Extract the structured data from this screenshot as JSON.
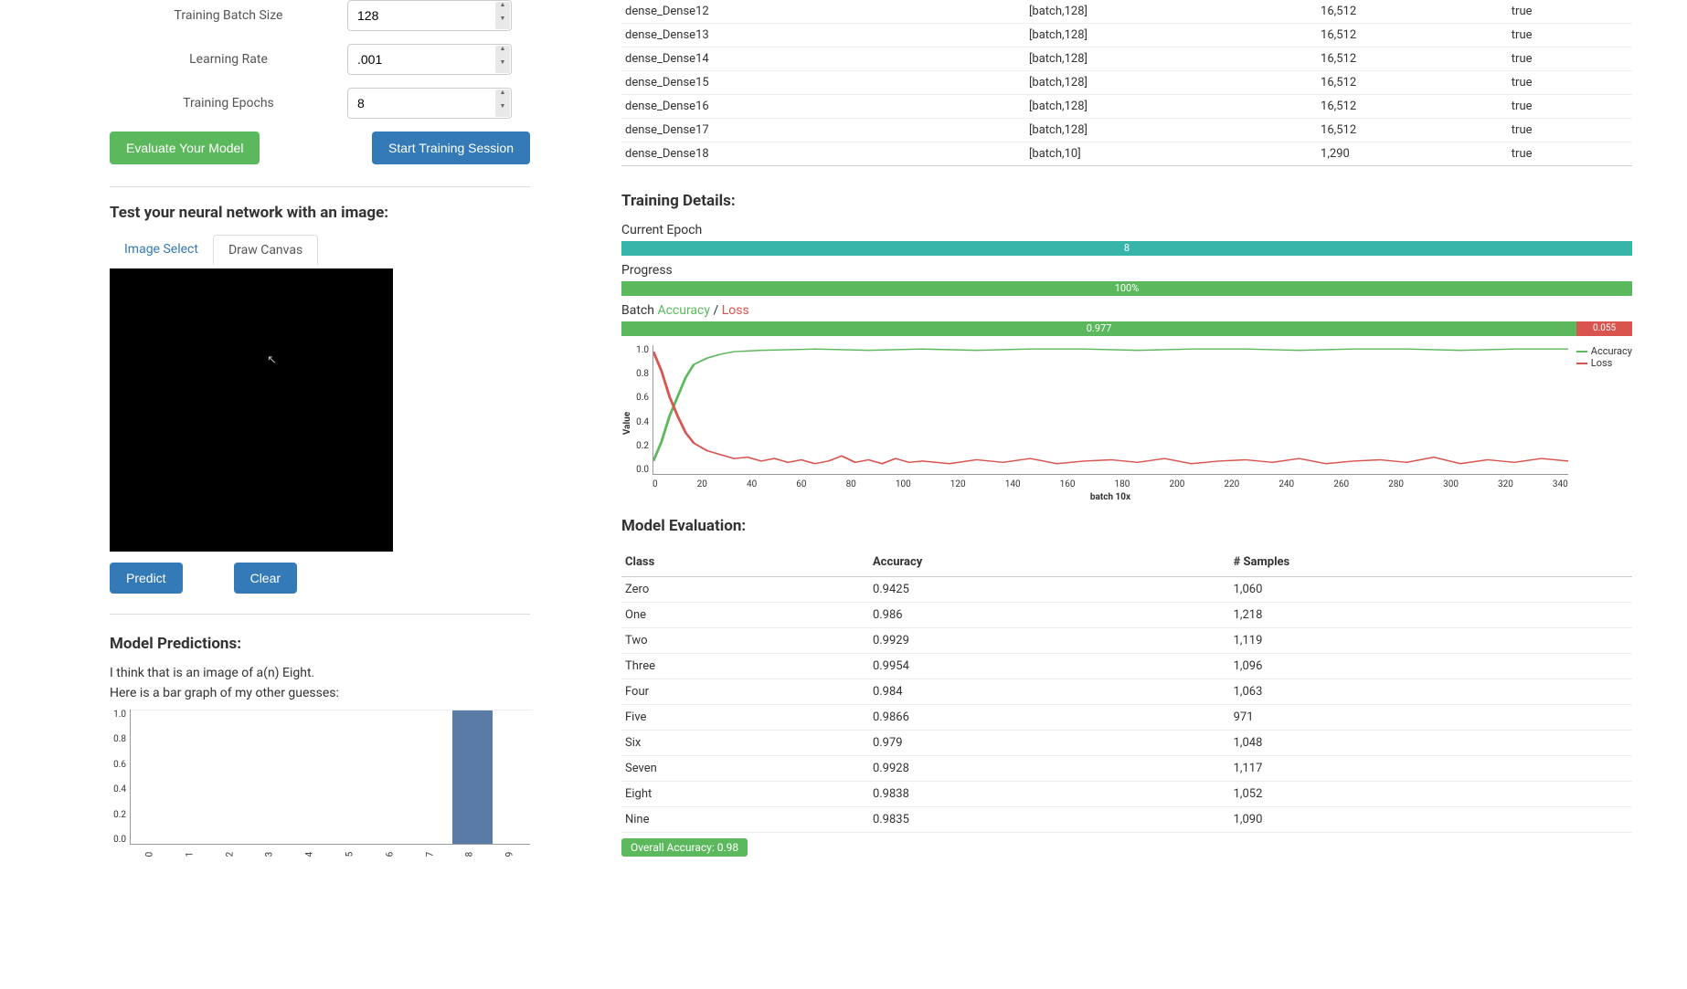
{
  "form": {
    "batch_label": "Training Batch Size",
    "batch_value": "128",
    "lr_label": "Learning Rate",
    "lr_value": ".001",
    "epochs_label": "Training Epochs",
    "epochs_value": "8",
    "evaluate_btn": "Evaluate Your Model",
    "train_btn": "Start Training Session"
  },
  "test": {
    "heading": "Test your neural network with an image:",
    "tab_select": "Image Select",
    "tab_draw": "Draw Canvas",
    "predict_btn": "Predict",
    "clear_btn": "Clear"
  },
  "predictions": {
    "heading": "Model Predictions:",
    "line1": "I think that is an image of a(n) Eight.",
    "line2": "Here is a bar graph of my other guesses:"
  },
  "chart_data": {
    "predictions_bar": {
      "type": "bar",
      "categories": [
        "0",
        "1",
        "2",
        "3",
        "4",
        "5",
        "6",
        "7",
        "8",
        "9"
      ],
      "values": [
        0,
        0,
        0,
        0,
        0,
        0,
        0,
        0,
        1.0,
        0
      ],
      "ylim": [
        0,
        1.0
      ],
      "yticks": [
        "0.0",
        "0.2",
        "0.4",
        "0.6",
        "0.8",
        "1.0"
      ]
    },
    "training_line": {
      "type": "line",
      "xlabel": "batch 10x",
      "ylabel": "Value",
      "xlim": [
        0,
        340
      ],
      "ylim": [
        0,
        1.0
      ],
      "xticks": [
        "0",
        "20",
        "40",
        "60",
        "80",
        "100",
        "120",
        "140",
        "160",
        "180",
        "200",
        "220",
        "240",
        "260",
        "280",
        "300",
        "320",
        "340"
      ],
      "yticks": [
        "0.0",
        "0.2",
        "0.4",
        "0.6",
        "0.8",
        "1.0"
      ],
      "series": [
        {
          "name": "Accuracy",
          "color": "#5cb85c",
          "values_summary": "rises from ~0.1 to ~0.97 by batch ~30 then plateaus near 0.97"
        },
        {
          "name": "Loss",
          "color": "#d9534f",
          "values_summary": "drops from ~1.0 to ~0.1 by batch ~30 then noisy around 0.05-0.15"
        }
      ]
    }
  },
  "layers": [
    {
      "name": "dense_Dense12",
      "shape": "[batch,128]",
      "params": "16,512",
      "trainable": "true"
    },
    {
      "name": "dense_Dense13",
      "shape": "[batch,128]",
      "params": "16,512",
      "trainable": "true"
    },
    {
      "name": "dense_Dense14",
      "shape": "[batch,128]",
      "params": "16,512",
      "trainable": "true"
    },
    {
      "name": "dense_Dense15",
      "shape": "[batch,128]",
      "params": "16,512",
      "trainable": "true"
    },
    {
      "name": "dense_Dense16",
      "shape": "[batch,128]",
      "params": "16,512",
      "trainable": "true"
    },
    {
      "name": "dense_Dense17",
      "shape": "[batch,128]",
      "params": "16,512",
      "trainable": "true"
    },
    {
      "name": "dense_Dense18",
      "shape": "[batch,10]",
      "params": "1,290",
      "trainable": "true"
    }
  ],
  "training": {
    "heading": "Training Details:",
    "epoch_label": "Current Epoch",
    "epoch_value": "8",
    "progress_label": "Progress",
    "progress_value": "100%",
    "batch_label_prefix": "Batch ",
    "batch_acc_word": "Accuracy",
    "batch_sep": " / ",
    "batch_loss_word": "Loss",
    "acc_value": "0.977",
    "loss_value": "0.055",
    "legend_acc": "Accuracy",
    "legend_loss": "Loss"
  },
  "evaluation": {
    "heading": "Model Evaluation:",
    "col_class": "Class",
    "col_acc": "Accuracy",
    "col_samples": "# Samples",
    "rows": [
      {
        "class": "Zero",
        "acc": "0.9425",
        "samples": "1,060"
      },
      {
        "class": "One",
        "acc": "0.986",
        "samples": "1,218"
      },
      {
        "class": "Two",
        "acc": "0.9929",
        "samples": "1,119"
      },
      {
        "class": "Three",
        "acc": "0.9954",
        "samples": "1,096"
      },
      {
        "class": "Four",
        "acc": "0.984",
        "samples": "1,063"
      },
      {
        "class": "Five",
        "acc": "0.9866",
        "samples": "971"
      },
      {
        "class": "Six",
        "acc": "0.979",
        "samples": "1,048"
      },
      {
        "class": "Seven",
        "acc": "0.9928",
        "samples": "1,117"
      },
      {
        "class": "Eight",
        "acc": "0.9838",
        "samples": "1,052"
      },
      {
        "class": "Nine",
        "acc": "0.9835",
        "samples": "1,090"
      }
    ],
    "overall": "Overall Accuracy: 0.98"
  }
}
